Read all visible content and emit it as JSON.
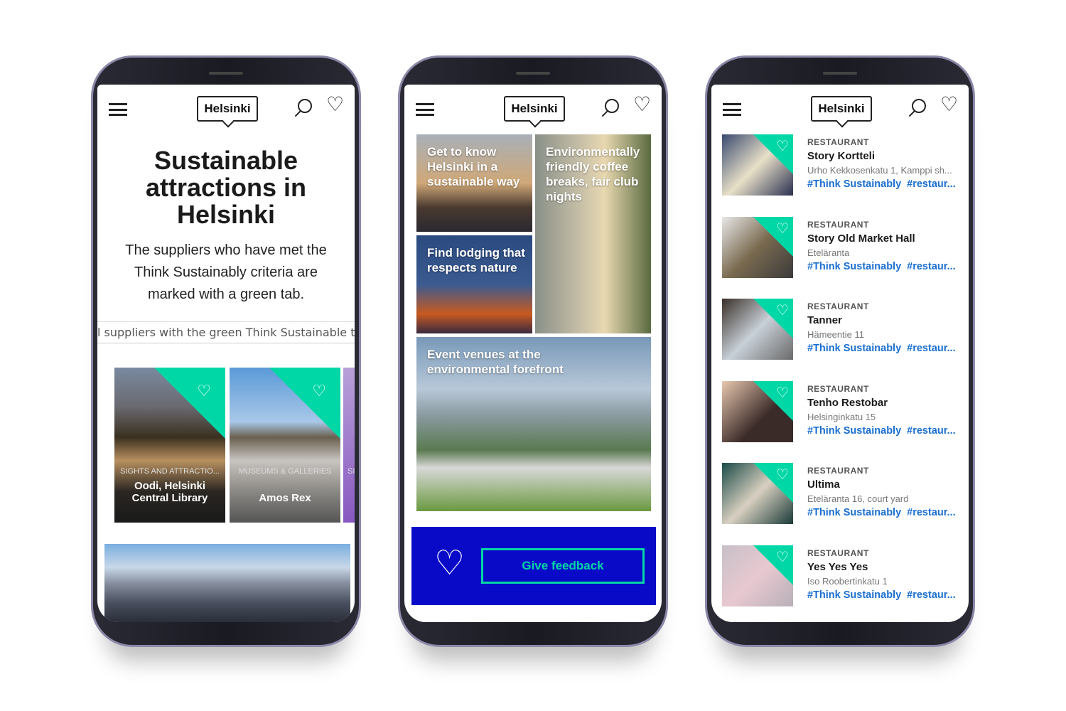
{
  "brand": {
    "logo": "Helsinki",
    "accent": "#00d7a7",
    "feedback_bg": "#0909c8",
    "link": "#1a6fd0"
  },
  "phone1": {
    "title": "Sustainable attractions in Helsinki",
    "lead": "The suppliers who have met the Think Sustainably criteria are marked with a green tab.",
    "marquee": "l suppliers with the green Think Sustainable ta",
    "cards": [
      {
        "category": "SIGHTS AND ATTRACTIO...",
        "name": "Oodi, Helsinki Central Library"
      },
      {
        "category": "MUSEUMS & GALLERIES",
        "name": "Amos Rex"
      },
      {
        "category": "SI",
        "name": ""
      }
    ]
  },
  "phone2": {
    "tiles": [
      {
        "label": "Get to know Helsinki in a sustainable way"
      },
      {
        "label": "Environmentally friendly coffee breaks, fair club nights"
      },
      {
        "label": "Find lodging that respects nature"
      },
      {
        "label": "Event venues at the environmental forefront"
      }
    ],
    "feedback_label": "Give feedback"
  },
  "phone3": {
    "items": [
      {
        "category": "RESTAURANT",
        "name": "Story Kortteli",
        "address": "Urho Kekkosenkatu 1, Kamppi sh...",
        "tags": [
          "#Think Sustainably",
          "#restaur..."
        ]
      },
      {
        "category": "RESTAURANT",
        "name": "Story Old Market Hall",
        "address": "Eteläranta",
        "tags": [
          "#Think Sustainably",
          "#restaur..."
        ]
      },
      {
        "category": "RESTAURANT",
        "name": "Tanner",
        "address": "Hämeentie 11",
        "tags": [
          "#Think Sustainably",
          "#restaur..."
        ]
      },
      {
        "category": "RESTAURANT",
        "name": "Tenho Restobar",
        "address": "Helsinginkatu 15",
        "tags": [
          "#Think Sustainably",
          "#restaur..."
        ]
      },
      {
        "category": "RESTAURANT",
        "name": "Ultima",
        "address": "Eteläranta 16, court yard",
        "tags": [
          "#Think Sustainably",
          "#restaur..."
        ]
      },
      {
        "category": "RESTAURANT",
        "name": "Yes Yes Yes",
        "address": "Iso Roobertinkatu 1",
        "tags": [
          "#Think Sustainably",
          "#restaur..."
        ]
      }
    ]
  }
}
